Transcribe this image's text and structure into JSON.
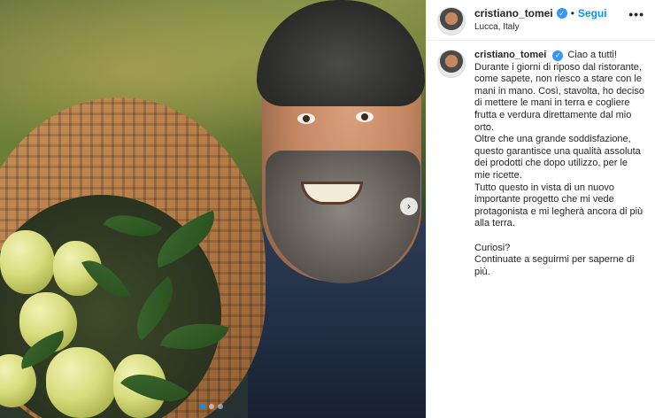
{
  "media": {
    "carousel_total": 3,
    "carousel_active_index": 0
  },
  "header": {
    "username": "cristiano_tomei",
    "separator": "•",
    "follow_label": "Segui",
    "location": "Lucca, Italy",
    "more_label": "•••"
  },
  "caption": {
    "username": "cristiano_tomei",
    "paragraphs": [
      "Ciao a tutti!",
      "Durante i giorni di riposo dal ristorante, come sapete, non riesco a stare con le mani in mano. Così, stavolta, ho deciso di mettere le mani in terra e cogliere frutta e verdura direttamente dal mio orto.",
      "Oltre che una grande soddisfazione, questo garantisce una qualità assoluta dei prodotti che dopo utilizzo, per le mie ricette.",
      "Tutto questo in vista di un nuovo importante progetto che mi vede protagonista e mi legherà ancora di più alla terra.",
      "",
      "Curiosi?",
      "Continuate a seguirmi per saperne di più."
    ]
  },
  "colors": {
    "accent": "#0095f6",
    "verified": "#3897f0",
    "text": "#262626"
  },
  "icons": {
    "verified": "verified-badge-icon",
    "next": "chevron-right-icon",
    "more": "more-options-icon"
  }
}
